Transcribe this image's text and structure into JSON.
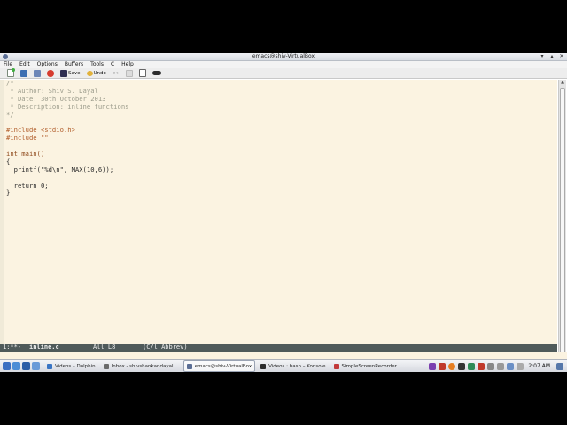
{
  "window": {
    "title": "emacs@shiv-VirtualBox"
  },
  "menubar": {
    "items": [
      "File",
      "Edit",
      "Options",
      "Buffers",
      "Tools",
      "C",
      "Help"
    ]
  },
  "toolbar": {
    "save_label": "Save",
    "undo_label": "Undo"
  },
  "editor": {
    "lines": [
      "/*",
      " * Author: Shiv S. Dayal",
      " * Date: 30th October 2013",
      " * Description: inline functions",
      "*/",
      "",
      "#include <stdio.h>",
      "#include \"\"",
      "",
      "int main()",
      "{",
      "  printf(\"%d\\n\", MAX(10,6));",
      "",
      "  return 0;",
      "}"
    ]
  },
  "modeline": {
    "status": "1:**-",
    "buffer": "inline.c",
    "position": "All L8",
    "mode": "(C/l Abbrev)"
  },
  "taskbar": {
    "tasks": [
      {
        "label": "Videos – Dolphin",
        "color": "#3a75c4"
      },
      {
        "label": "Inbox - shivshankar.dayal...",
        "color": "#6b6b6b"
      },
      {
        "label": "emacs@shiv-VirtualBox",
        "color": "#5b6e95"
      },
      {
        "label": "Videos : bash – Konsole",
        "color": "#2d2d2d"
      },
      {
        "label": "SimpleScreenRecorder",
        "color": "#c23a3a"
      }
    ],
    "clock": "2:07 AM"
  },
  "colors": {
    "editor_bg": "#fbf3e1",
    "modeline_bg": "#4f5a5a",
    "comment": "#9c9c8c",
    "preprocessor": "#b15d2a",
    "string": "#8a9a3b"
  }
}
